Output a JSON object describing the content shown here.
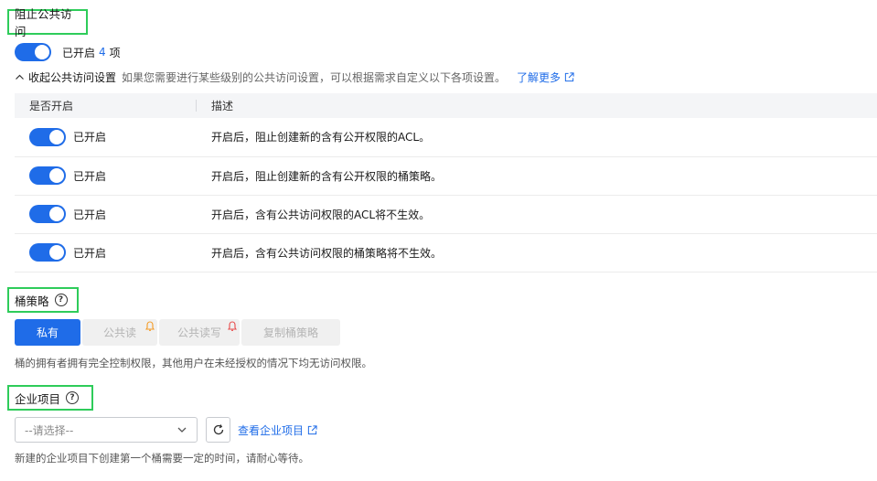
{
  "block_public": {
    "title": "阻止公共访问",
    "status_text": "已开启",
    "count": "4",
    "count_unit": "项",
    "collapse_label": "收起公共访问设置",
    "description": "如果您需要进行某些级别的公共访问设置，可以根据需求自定义以下各项设置。",
    "learn_more": "了解更多",
    "table": {
      "headers": [
        "是否开启",
        "描述"
      ],
      "rows": [
        {
          "status": "已开启",
          "desc": "开启后，阻止创建新的含有公开权限的ACL。"
        },
        {
          "status": "已开启",
          "desc": "开启后，阻止创建新的含有公开权限的桶策略。"
        },
        {
          "status": "已开启",
          "desc": "开启后，含有公共访问权限的ACL将不生效。"
        },
        {
          "status": "已开启",
          "desc": "开启后，含有公共访问权限的桶策略将不生效。"
        }
      ]
    }
  },
  "bucket_policy": {
    "title": "桶策略",
    "options": [
      "私有",
      "公共读",
      "公共读写",
      "复制桶策略"
    ],
    "selected": "私有",
    "hint": "桶的拥有者拥有完全控制权限，其他用户在未经授权的情况下均无访问权限。"
  },
  "enterprise_project": {
    "title": "企业项目",
    "select_value": "--请选择--",
    "view_link": "查看企业项目",
    "hint": "新建的企业项目下创建第一个桶需要一定的时间，请耐心等待。"
  },
  "colors": {
    "primary": "#1f6ce8",
    "highlight_border": "#2ecc5a",
    "warning_bell_orange": "#f59a23",
    "warning_bell_red": "#e84a4a"
  }
}
